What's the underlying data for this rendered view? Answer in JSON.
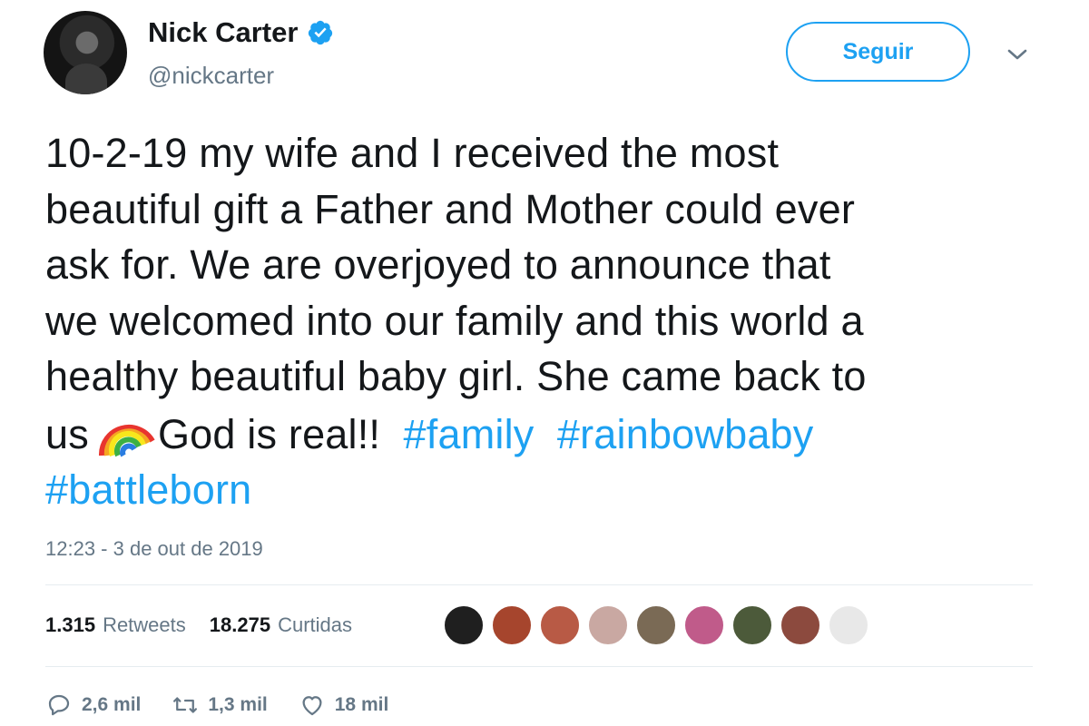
{
  "author": {
    "name": "Nick Carter",
    "handle": "@nickcarter"
  },
  "follow_label": "Seguir",
  "tweet": {
    "lines": [
      "10-2-19 my wife and I received the most",
      "beautiful gift a Father and Mother could ever",
      "ask for. We are overjoyed to announce that",
      "we welcomed into our family and this world a",
      "healthy beautiful baby girl. She came back to"
    ],
    "line6_start": "us",
    "line6_text": "God is real!!",
    "hashtags": [
      "#family",
      "#rainbowbaby",
      "#battleborn"
    ]
  },
  "timestamp": "12:23 - 3 de out de 2019",
  "stats": {
    "retweets_count": "1.315",
    "retweets_label": "Retweets",
    "likes_count": "18.275",
    "likes_label": "Curtidas"
  },
  "likers": [
    {
      "color": "#1f1f1f"
    },
    {
      "color": "#a6452d"
    },
    {
      "color": "#b85a45"
    },
    {
      "color": "#c9a8a2"
    },
    {
      "color": "#7a6a55"
    },
    {
      "color": "#c05b8a"
    },
    {
      "color": "#4c5a3a"
    },
    {
      "color": "#8c4a3e"
    },
    {
      "color": "#e8e8e8"
    }
  ],
  "actions": {
    "replies": "2,6 mil",
    "retweets": "1,3 mil",
    "likes": "18 mil"
  },
  "colors": {
    "accent": "#1da1f2",
    "text": "#14171a",
    "secondary": "#657786"
  }
}
